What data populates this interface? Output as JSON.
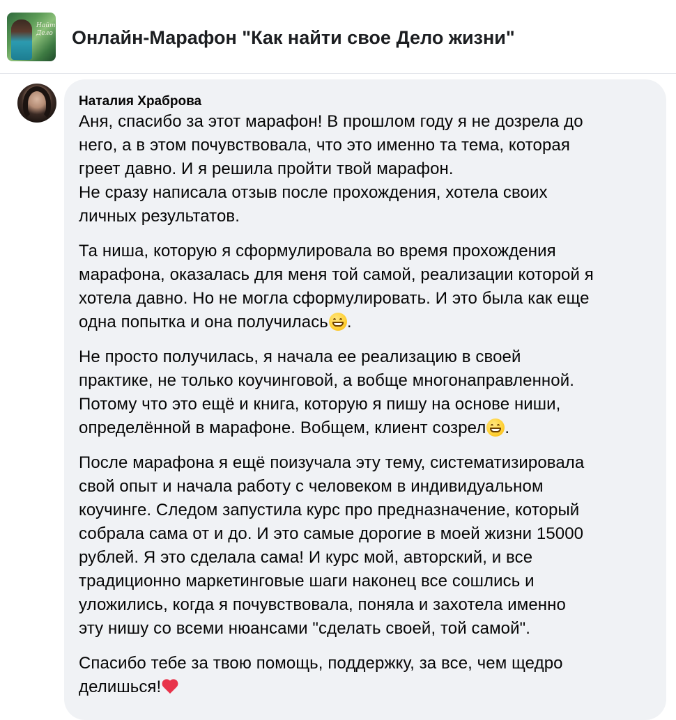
{
  "header": {
    "group_title": "Онлайн-Марафон \"Как найти свое Дело жизни\"",
    "group_avatar_icon": "group-cover-image"
  },
  "comment": {
    "author": "Наталия Храброва",
    "avatar_icon": "user-profile-photo",
    "bubble_color": "#f0f2f5",
    "paragraphs": [
      {
        "text": "Аня, спасибо за этот марафон! В прошлом году я не дозрела до\nнего, а в этом почувствовала, что это именно та тема, которая\nгреет давно. И я решила пройти твой марафон.\nНе сразу написала отзыв после прохождения, хотела своих\nличных результатов."
      },
      {
        "text": "Та ниша, которую я сформулировала во время прохождения\nмарафона, оказалась для меня той самой, реализации которой я\nхотела давно. Но не могла сформулировать. И это была как еще\nодна попытка и она получилась",
        "tail": ".",
        "emoji": "grinning-face-icon"
      },
      {
        "text": "Не просто получилась, я начала ее реализацию в своей\nпрактике, не только коучинговой, а вобще многонаправленной.\nПотому что это ещё и книга, которую я пишу на основе ниши,\nопределённой в марафоне. Вобщем, клиент созрел",
        "tail": ".",
        "emoji": "grinning-face-icon"
      },
      {
        "text": "После марафона я ещё поизучала эту тему, систематизировала\nсвой опыт и начала работу с человеком в индивидуальном\nкоучинге. Следом запустила курс про предназначение, который\nсобрала сама от и до. И это самые дорогие в моей жизни 15000\nрублей. Я это сделала сама! И курс мой, авторский, и все\nтрадиционно маркетинговые шаги наконец все сошлись и\nуложились, когда я почувствовала, поняла и захотела именно\nэту нишу со всеми нюансами \"сделать своей, той самой\"."
      },
      {
        "text": "Спасибо тебе за твою помощь, поддержку, за все, чем щедро\nделишься!",
        "emoji": "red-heart-icon"
      }
    ]
  }
}
